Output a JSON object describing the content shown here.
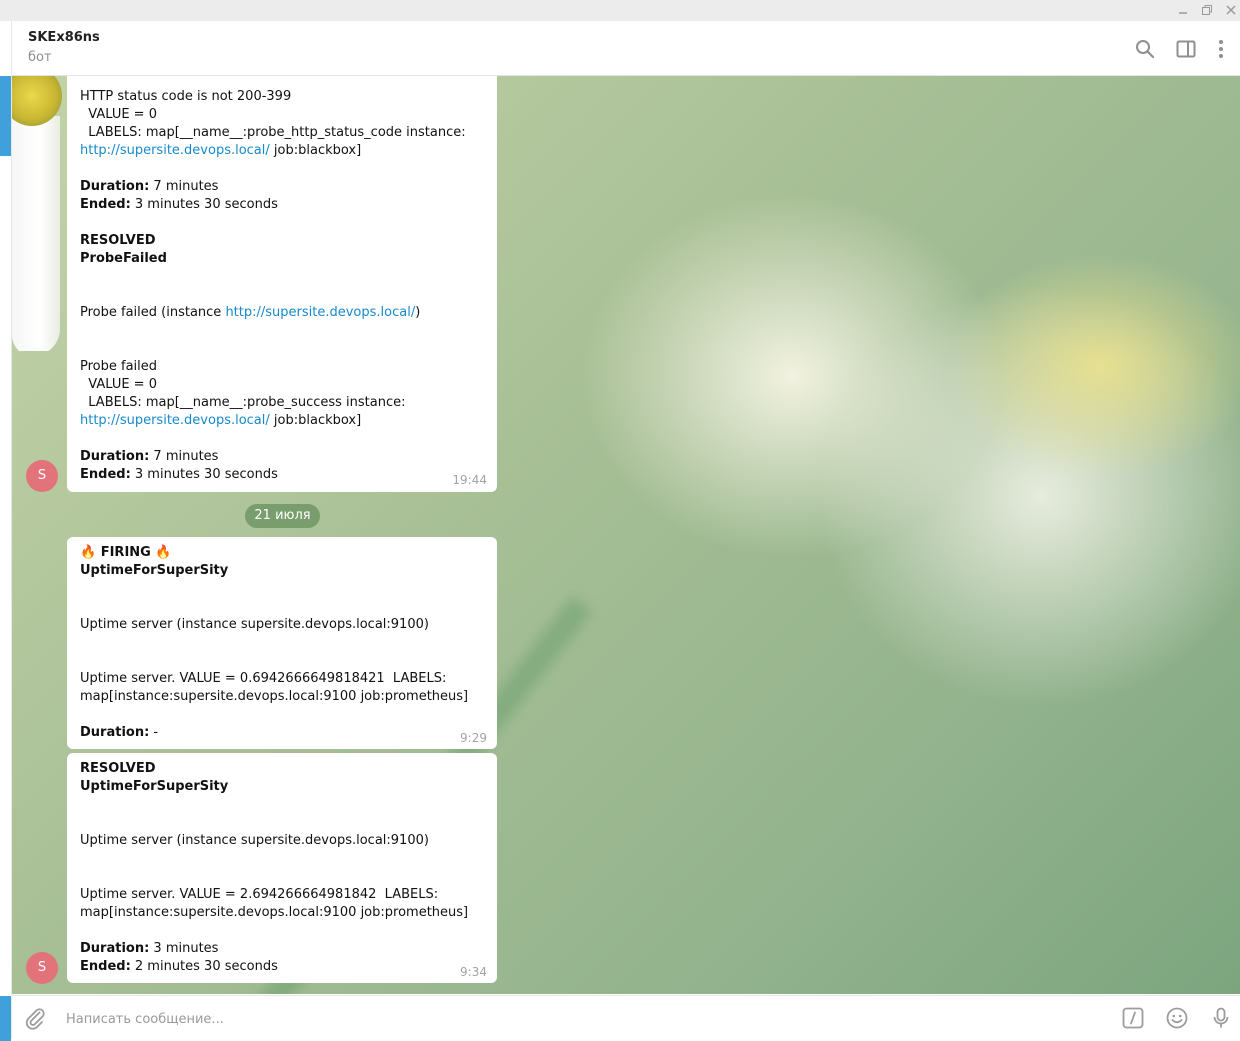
{
  "window": {
    "controls": {
      "minimize": "—",
      "restore": "❐",
      "close": "✕"
    }
  },
  "header": {
    "title": "SKEx86ns",
    "status": "бот",
    "icons": [
      "search-icon",
      "sidebar-toggle-icon",
      "more-vertical-icon"
    ]
  },
  "messages": {
    "m1": {
      "lines": [
        "HTTP status code is not 200-399",
        "  VALUE = 0",
        "  LABELS: map[__name__:probe_http_status_code instance:"
      ],
      "link1": "http://supersite.devops.local/",
      "suffix1": " job:blackbox]",
      "duration_label": "Duration:",
      "duration_value": " 7 minutes",
      "ended_label": "Ended:",
      "ended_value": " 3 minutes 30 seconds",
      "status": "RESOLVED",
      "alertname": "ProbeFailed",
      "summary_prefix": "Probe failed (instance ",
      "summary_link": "http://supersite.devops.local/",
      "summary_suffix": ")",
      "desc1": "Probe failed",
      "desc2": "  VALUE = 0",
      "desc3": "  LABELS: map[__name__:probe_success instance:",
      "link2": "http://supersite.devops.local/",
      "suffix2": " job:blackbox]",
      "duration2_label": "Duration:",
      "duration2_value": " 7 minutes",
      "ended2_label": "Ended:",
      "ended2_value": " 3 minutes 30 seconds",
      "time": "19:44",
      "avatar": "S"
    },
    "date_separator": "21 июля",
    "m2": {
      "firing": "FIRING",
      "fire_icon": "🔥",
      "alertname": "UptimeForSuperSity",
      "summary": "Uptime server (instance supersite.devops.local:9100)",
      "desc1": "Uptime server. VALUE = 0.6942666649818421  LABELS:",
      "desc2": "map[instance:supersite.devops.local:9100 job:prometheus]",
      "duration_label": "Duration:",
      "duration_value": " -",
      "time": "9:29"
    },
    "m3": {
      "status": "RESOLVED",
      "alertname": "UptimeForSuperSity",
      "summary": "Uptime server (instance supersite.devops.local:9100)",
      "desc1": "Uptime server. VALUE = 2.694266664981842  LABELS:",
      "desc2": "map[instance:supersite.devops.local:9100 job:prometheus]",
      "duration_label": "Duration:",
      "duration_value": " 3 minutes",
      "ended_label": "Ended:",
      "ended_value": " 2 minutes 30 seconds",
      "time": "9:34",
      "avatar": "S"
    }
  },
  "composer": {
    "placeholder": "Написать сообщение...",
    "icons": [
      "attach-icon",
      "bot-commands-icon",
      "emoji-icon",
      "microphone-icon"
    ]
  },
  "colors": {
    "link": "#168acd",
    "avatar": "#e2737b",
    "accent": "#3fa0dc"
  }
}
